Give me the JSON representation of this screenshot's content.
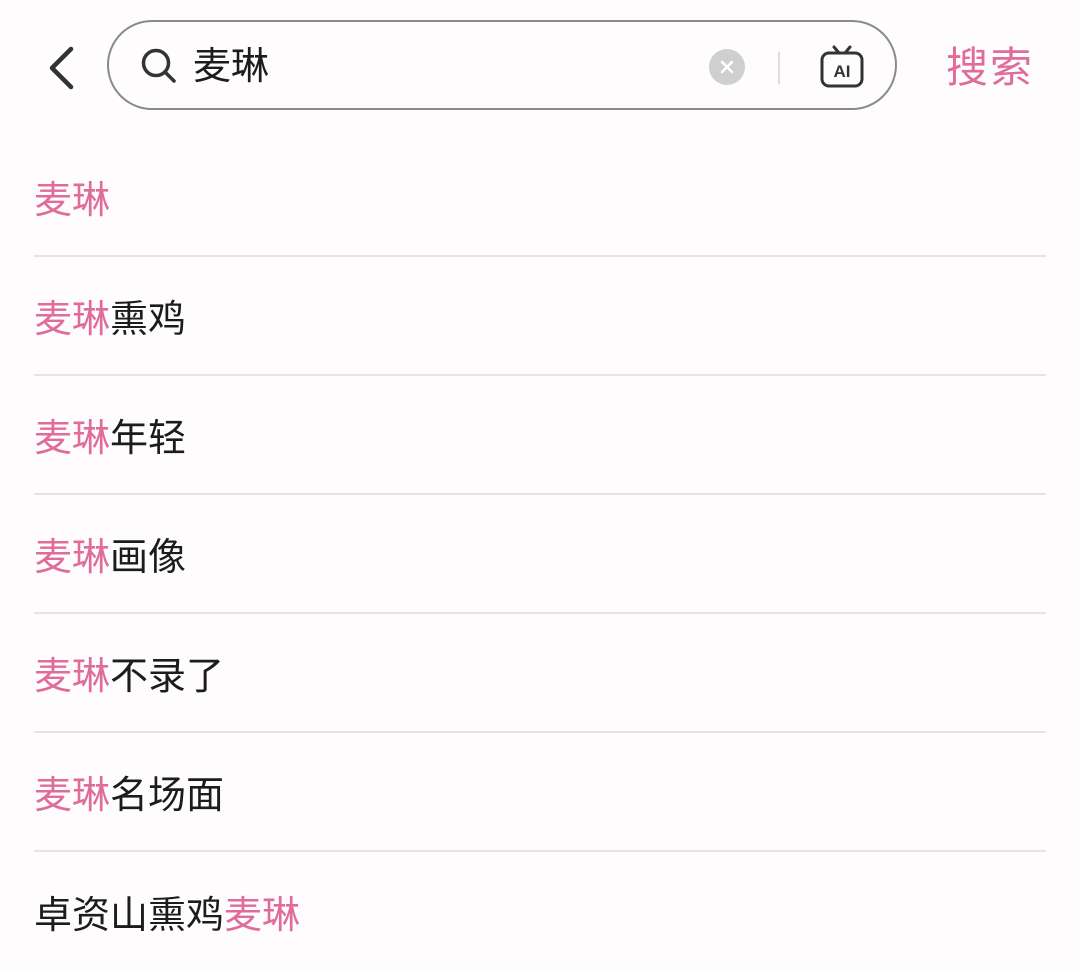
{
  "search": {
    "query": "麦琳",
    "action_label": "搜索",
    "ai_label": "AI"
  },
  "colors": {
    "accent": "#e06c9a",
    "text": "#1c1c1c",
    "divider": "#e6e3e5",
    "border": "#8a8a8a"
  },
  "icons": {
    "back": "chevron-left-icon",
    "search": "search-icon",
    "clear": "clear-icon",
    "ai": "ai-tv-icon"
  },
  "suggestions": [
    {
      "highlight_first": true,
      "parts": [
        "麦琳",
        ""
      ]
    },
    {
      "highlight_first": true,
      "parts": [
        "麦琳",
        "熏鸡"
      ]
    },
    {
      "highlight_first": true,
      "parts": [
        "麦琳",
        "年轻"
      ]
    },
    {
      "highlight_first": true,
      "parts": [
        "麦琳",
        "画像"
      ]
    },
    {
      "highlight_first": true,
      "parts": [
        "麦琳",
        "不录了"
      ]
    },
    {
      "highlight_first": true,
      "parts": [
        "麦琳",
        "名场面"
      ]
    },
    {
      "highlight_first": false,
      "parts": [
        "卓资山熏鸡",
        "麦琳"
      ]
    }
  ]
}
